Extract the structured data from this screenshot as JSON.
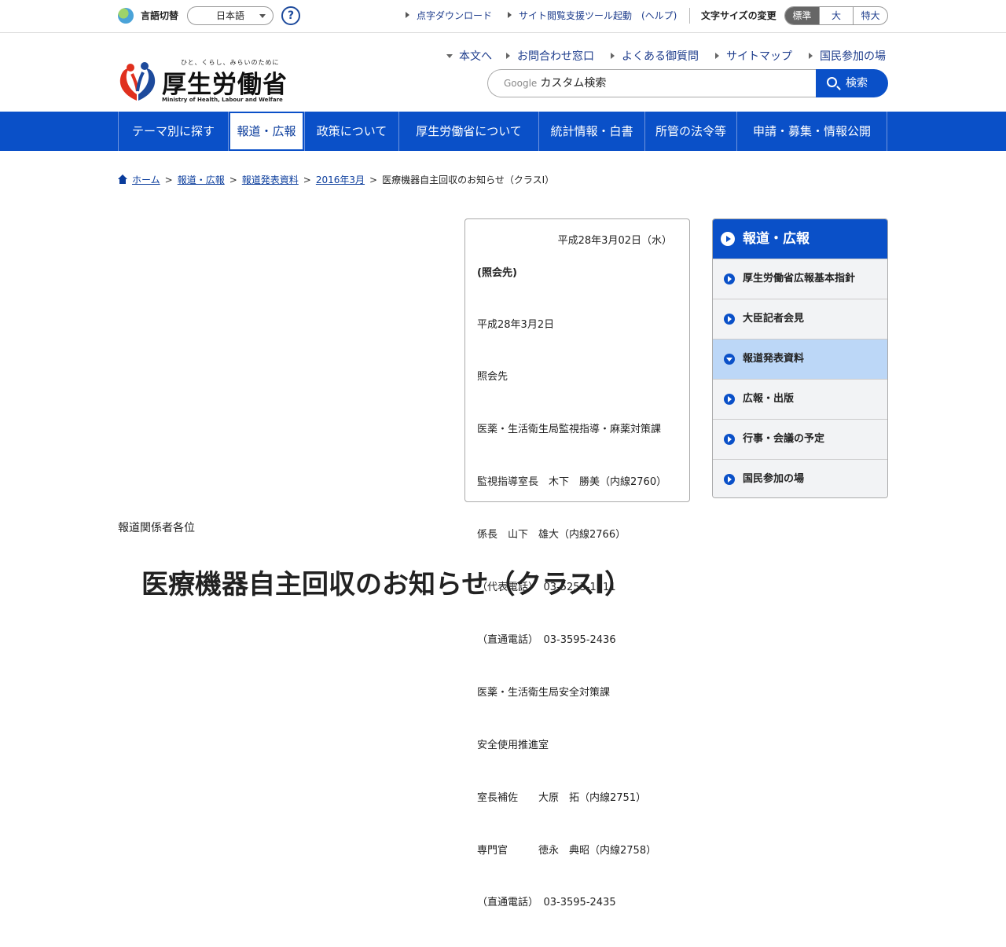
{
  "utility": {
    "lang_label": "言語切替",
    "lang_value": "日本語",
    "help_label": "?",
    "links": [
      "点字ダウンロード",
      "サイト閲覧支援ツール起動",
      "(ヘルプ)"
    ],
    "font_size_label": "文字サイズの変更",
    "font_sizes": [
      "標準",
      "大",
      "特大"
    ]
  },
  "header": {
    "logo_tagline": "ひと、くらし、みらいのために",
    "logo_name": "厚生労働省",
    "logo_english": "Ministry of Health, Labour and Welfare",
    "links": [
      "本文へ",
      "お問合わせ窓口",
      "よくある御質問",
      "サイトマップ",
      "国民参加の場"
    ],
    "search_prefix": "Google",
    "search_placeholder": "カスタム検索",
    "search_button": "検索"
  },
  "nav": {
    "items": [
      "テーマ別に探す",
      "報道・広報",
      "政策について",
      "厚生労働省について",
      "統計情報・白書",
      "所管の法令等",
      "申請・募集・情報公開"
    ],
    "active_index": 1
  },
  "breadcrumb": {
    "items": [
      "ホーム",
      "報道・広報",
      "報道発表資料",
      "2016年3月"
    ],
    "current": "医療機器自主回収のお知らせ（クラスI）",
    "separator": ">"
  },
  "contact": {
    "date": "平成28年3月02日（水）",
    "title": "(照会先)",
    "lines": [
      "平成28年3月2日",
      "照会先",
      "医薬・生活衛生局監視指導・麻薬対策課",
      "監視指導室長　木下　勝美（内線2760）",
      "係長　山下　雄大（内線2766）",
      "（代表電話）　03-5253-1111",
      "（直通電話）　03-3595-2436",
      "医薬・生活衛生局安全対策課",
      "安全使用推進室",
      "室長補佐　　大原　拓（内線2751）",
      "専門官　　　徳永　典昭（内線2758）",
      "（直通電話）　03-3595-2435"
    ]
  },
  "side": {
    "title": "報道・広報",
    "items": [
      "厚生労働省広報基本指針",
      "大臣記者会見",
      "報道発表資料",
      "広報・出版",
      "行事・会議の予定",
      "国民参加の場"
    ],
    "active_index": 2
  },
  "body": {
    "recipients": "報道関係者各位",
    "title": "医療機器自主回収のお知らせ（クラスI）"
  },
  "colors": {
    "brand_blue": "#0a50c8",
    "link_blue": "#1d3c8c",
    "active_side": "#bcd7f7"
  }
}
